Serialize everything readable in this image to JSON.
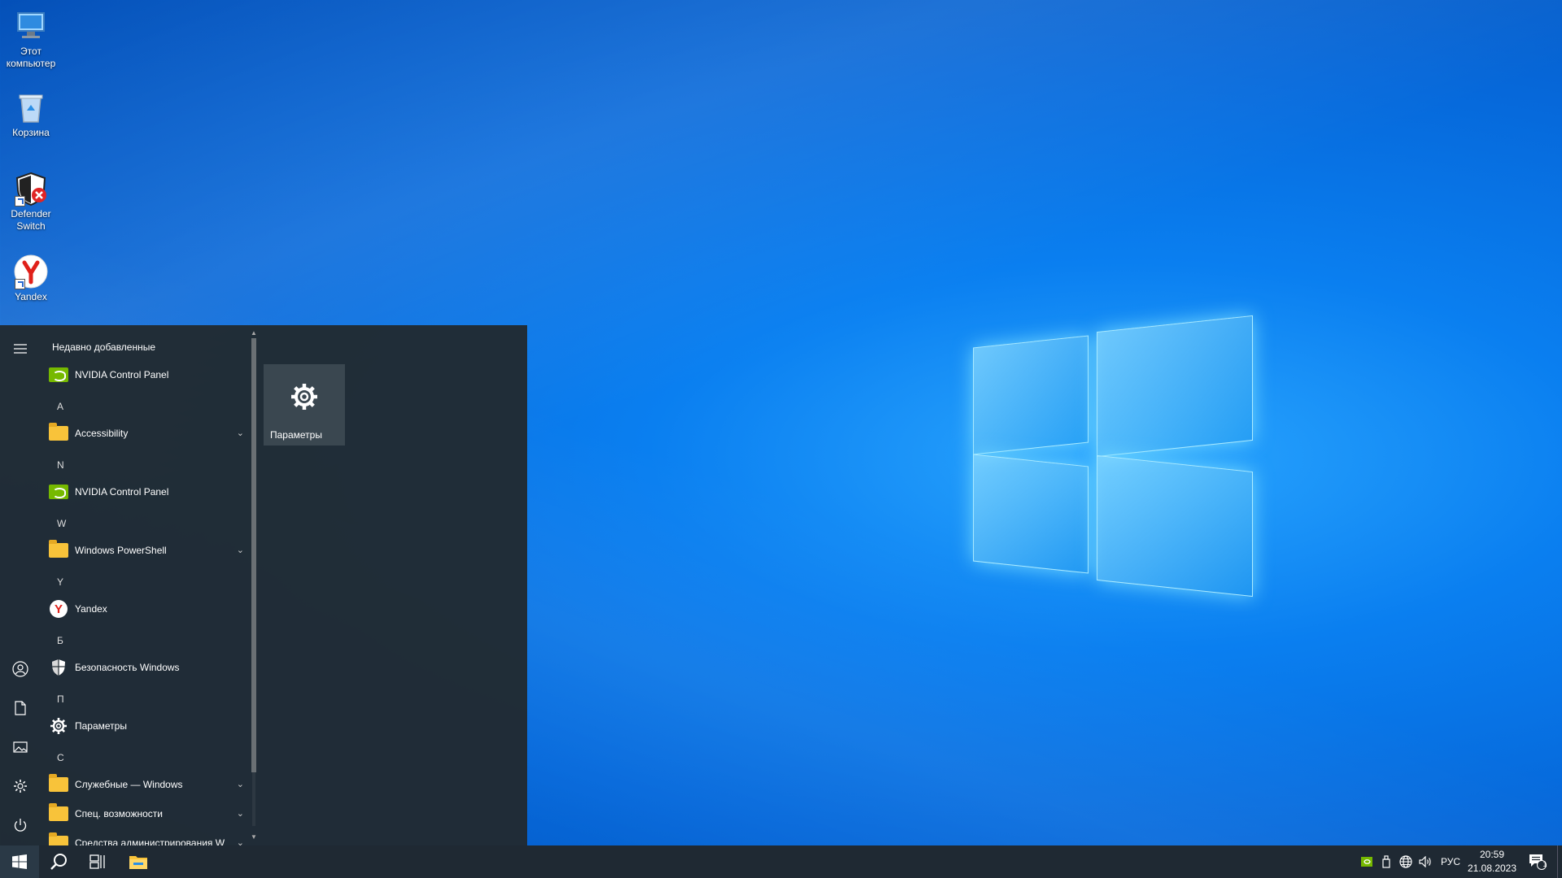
{
  "desktop": {
    "icons": [
      {
        "label": "Этот компьютер",
        "icon": "computer-icon"
      },
      {
        "label": "Корзина",
        "icon": "recycle-bin-icon"
      },
      {
        "label": "Defender Switch",
        "icon": "defender-shield-icon"
      },
      {
        "label": "Yandex",
        "icon": "yandex-icon"
      }
    ]
  },
  "start_menu": {
    "recent_header": "Недавно добавленные",
    "items": [
      {
        "label": "NVIDIA Control Panel",
        "icon": "nvidia-icon"
      },
      {
        "letter": "A"
      },
      {
        "label": "Accessibility",
        "icon": "folder-icon",
        "expandable": true
      },
      {
        "letter": "N"
      },
      {
        "label": "NVIDIA Control Panel",
        "icon": "nvidia-icon"
      },
      {
        "letter": "W"
      },
      {
        "label": "Windows PowerShell",
        "icon": "folder-icon",
        "expandable": true
      },
      {
        "letter": "Y"
      },
      {
        "label": "Yandex",
        "icon": "yandex-icon"
      },
      {
        "letter": "Б"
      },
      {
        "label": "Безопасность Windows",
        "icon": "shield-icon"
      },
      {
        "letter": "П"
      },
      {
        "label": "Параметры",
        "icon": "gear-icon"
      },
      {
        "letter": "С"
      },
      {
        "label": "Служебные — Windows",
        "icon": "folder-icon",
        "expandable": true
      },
      {
        "label": "Спец. возможности",
        "icon": "folder-icon",
        "expandable": true
      },
      {
        "label": "Средства администрирования W",
        "icon": "folder-icon",
        "expandable": true
      }
    ],
    "tile": {
      "label": "Параметры",
      "icon": "gear-icon"
    },
    "rail_icons": [
      "hamburger-icon",
      "user-icon",
      "document-icon",
      "pictures-icon",
      "settings-icon",
      "power-icon"
    ]
  },
  "taskbar": {
    "icons": [
      "windows-start-icon",
      "search-icon",
      "task-view-icon",
      "file-explorer-icon"
    ],
    "tray_icons": [
      "nvidia-tray-icon",
      "usb-icon",
      "network-globe-icon",
      "volume-icon"
    ],
    "language": "РУС",
    "time": "20:59",
    "date": "21.08.2023",
    "notification_count": "1"
  }
}
